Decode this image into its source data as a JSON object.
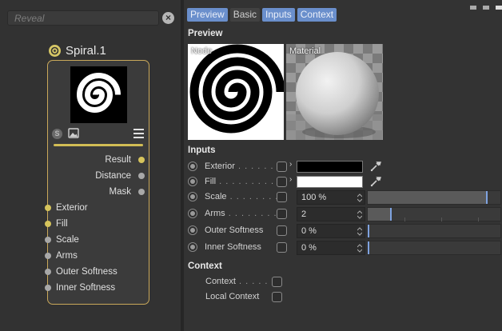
{
  "search": {
    "placeholder": "Reveal",
    "clear_icon": "close-icon"
  },
  "node": {
    "title": "Spiral.1",
    "icon": "node-type-icon",
    "outputs": [
      {
        "label": "Result",
        "color": "#d6c45c"
      },
      {
        "label": "Distance",
        "color": "#a8a8a8"
      },
      {
        "label": "Mask",
        "color": "#a8a8a8"
      }
    ],
    "inputs": [
      {
        "label": "Exterior",
        "color": "#d6c45c"
      },
      {
        "label": "Fill",
        "color": "#d6c45c"
      },
      {
        "label": "Scale",
        "color": "#a8a8a8"
      },
      {
        "label": "Arms",
        "color": "#a8a8a8"
      },
      {
        "label": "Outer Softness",
        "color": "#a8a8a8"
      },
      {
        "label": "Inner Softness",
        "color": "#a8a8a8"
      }
    ]
  },
  "tabs": [
    {
      "label": "Preview",
      "active": true
    },
    {
      "label": "Basic",
      "active": false
    },
    {
      "label": "Inputs",
      "active": true
    },
    {
      "label": "Context",
      "active": true
    }
  ],
  "preview": {
    "heading": "Preview",
    "node_label": "Node",
    "material_label": "Material"
  },
  "inputs": {
    "heading": "Inputs",
    "exterior": {
      "label": "Exterior",
      "dots": " . . . . . .",
      "color": "#000000"
    },
    "fill": {
      "label": "Fill",
      "dots": " . . . . . . . . . .",
      "color": "#ffffff"
    },
    "scale": {
      "label": "Scale",
      "dots": " . . . . . . . .",
      "value": "100 %",
      "level": 0.9
    },
    "arms": {
      "label": "Arms",
      "dots": " . . . . . . . .",
      "value": "2",
      "level": 0.17
    },
    "outer_softness": {
      "label": "Outer Softness",
      "value": "0 %",
      "level": 0
    },
    "inner_softness": {
      "label": "Inner Softness",
      "value": "0 %",
      "level": 0
    }
  },
  "context": {
    "heading": "Context",
    "items": [
      {
        "label": "Context",
        "dots": " . . . . ."
      },
      {
        "label": "Local Context",
        "dots": ""
      }
    ]
  },
  "accent": "#6a8fcc",
  "node_border": "#c9a85a"
}
